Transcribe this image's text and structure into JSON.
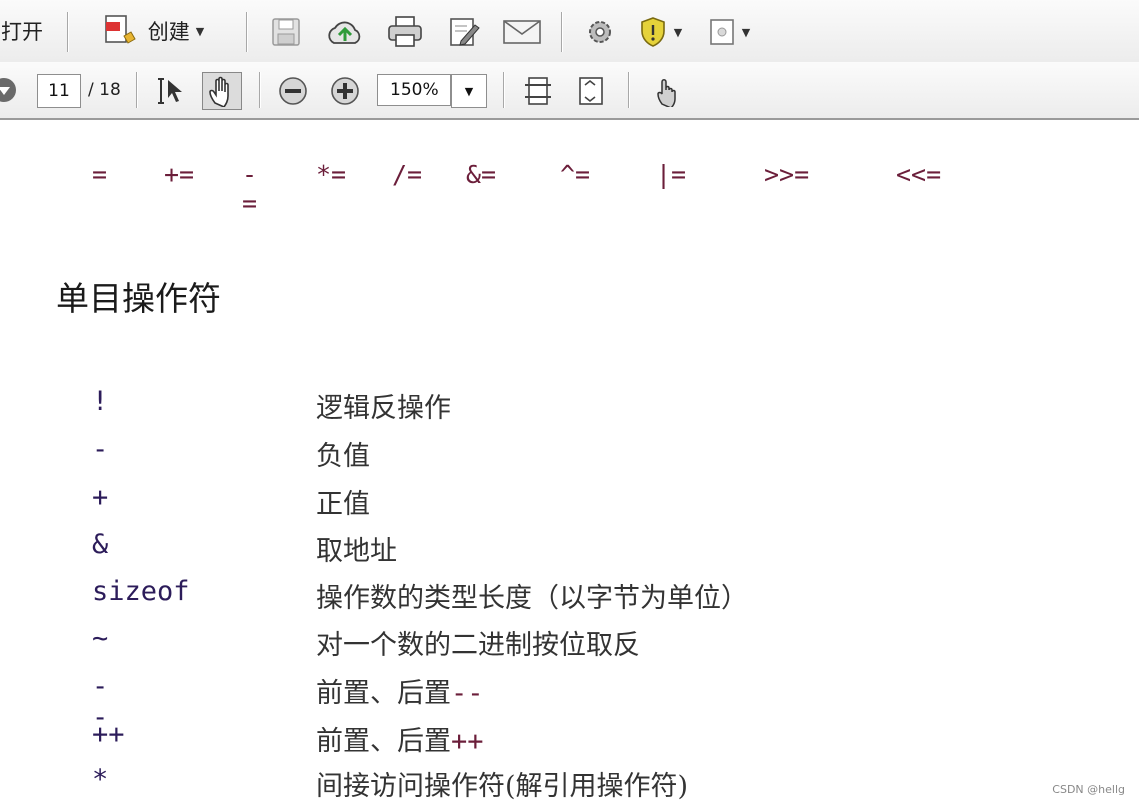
{
  "toolbar_top": {
    "open_label": "打开",
    "create_label": "创建",
    "icons": [
      "create-icon",
      "save-icon",
      "cloud-upload-icon",
      "print-icon",
      "edit-icon",
      "email-icon",
      "gear-icon",
      "shield-icon",
      "page-icon"
    ]
  },
  "toolbar_nav": {
    "page_current": "11",
    "page_total": "/ 18",
    "zoom_value": "150%",
    "icons": [
      "next-page-icon",
      "select-cursor-icon",
      "hand-tool-icon",
      "zoom-out-icon",
      "zoom-in-icon",
      "fit-width-icon",
      "fit-page-icon",
      "touch-icon"
    ]
  },
  "document": {
    "assignment_ops": [
      "=",
      "+=",
      "-=",
      "*=",
      "/=",
      "&=",
      "^=",
      "|=",
      ">>=",
      "<<="
    ],
    "unary_heading": "单目操作符",
    "unary_ops": [
      {
        "symbol": "!",
        "description": "逻辑反操作",
        "suffix": ""
      },
      {
        "symbol": "-",
        "description": "负值",
        "suffix": ""
      },
      {
        "symbol": "+",
        "description": "正值",
        "suffix": ""
      },
      {
        "symbol": "&",
        "description": "取地址",
        "suffix": ""
      },
      {
        "symbol": "sizeof",
        "description": "操作数的类型长度（以字节为单位）",
        "suffix": ""
      },
      {
        "symbol": "~",
        "description": "对一个数的二进制按位取反",
        "suffix": ""
      },
      {
        "symbol": "--",
        "description": "前置、后置",
        "suffix": "--"
      },
      {
        "symbol": "++",
        "description": "前置、后置",
        "suffix": "++"
      },
      {
        "symbol": "*",
        "description": "间接访问操作符(解引用操作符)",
        "suffix": ""
      }
    ]
  },
  "watermark": "CSDN @hellg",
  "colors": {
    "operator": "#6b1e3a",
    "symbol": "#2c1c5a",
    "toolbar_bg": "#efefef"
  }
}
